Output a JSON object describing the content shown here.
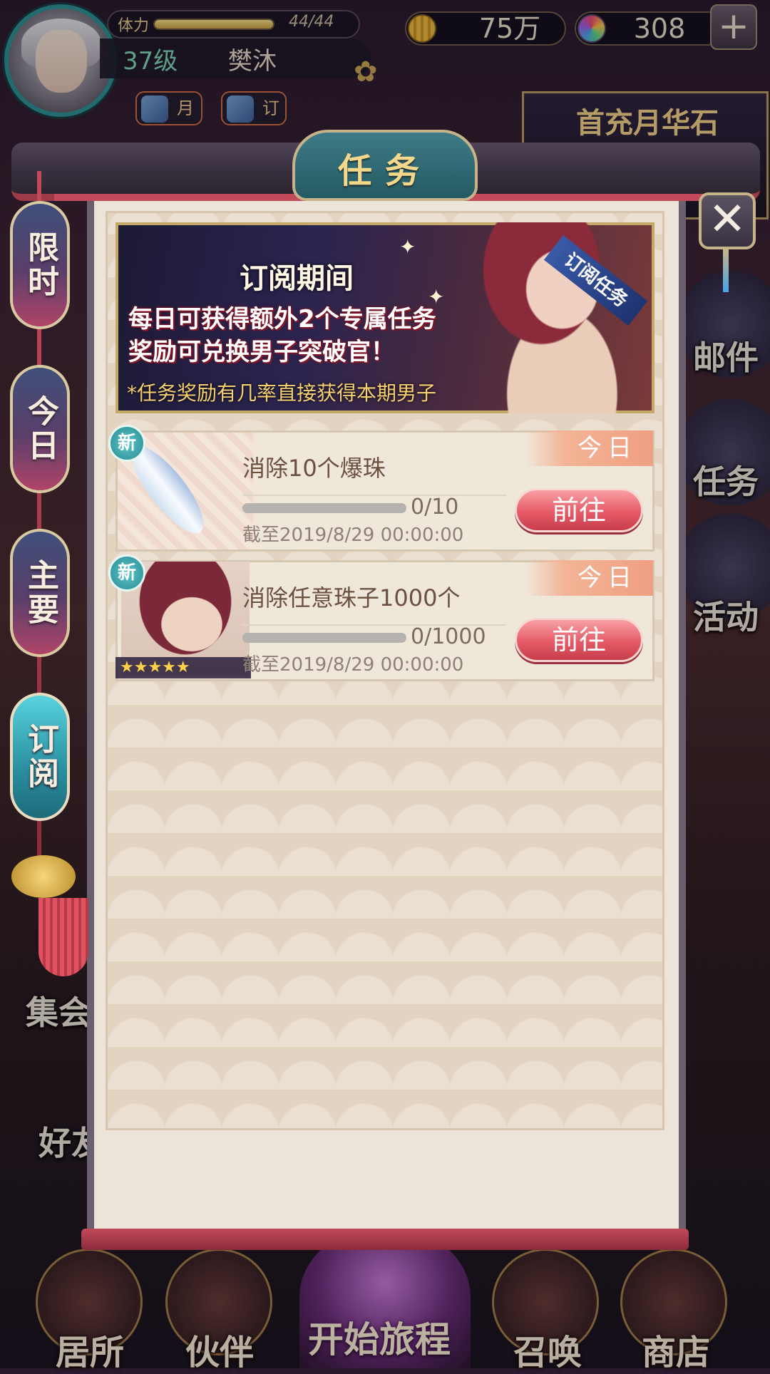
{
  "header": {
    "stamina_label": "体力",
    "stamina_value": "44/44",
    "stamina_fraction": 1.0,
    "level": "37级",
    "player_name": "樊沐",
    "coins": "75万",
    "gems": "308",
    "plus_label": "+",
    "mini_icons": [
      {
        "label": "月"
      },
      {
        "label": "订"
      }
    ],
    "promo_text": "首充月华石"
  },
  "modal": {
    "title": "任务",
    "close_label": "✕"
  },
  "tabs": [
    {
      "label": "限时",
      "active": false
    },
    {
      "label": "今日",
      "active": false
    },
    {
      "label": "主要",
      "active": false
    },
    {
      "label": "订阅",
      "active": true
    }
  ],
  "banner": {
    "title": "订阅期间",
    "line1": "每日可获得额外2个专属任务",
    "line2": "奖励可兑换男子突破官！",
    "note": "*任务奖励有几率直接获得本期男子",
    "ribbon": "订阅任务"
  },
  "tasks": [
    {
      "new_label": "新",
      "name": "消除10个爆珠",
      "progress": "0/10",
      "progress_fraction": 0,
      "deadline": "截至2019/8/29 00:00:00",
      "tag": "今日",
      "button": "前往"
    },
    {
      "new_label": "新",
      "name": "消除任意珠子1000个",
      "progress": "0/1000",
      "progress_fraction": 0,
      "deadline": "截至2019/8/29 00:00:00",
      "tag": "今日",
      "button": "前往",
      "rarity": "★★★★★"
    }
  ],
  "side_menu": [
    {
      "label": "邮件"
    },
    {
      "label": "任务"
    },
    {
      "label": "活动"
    }
  ],
  "left_menu": [
    {
      "label": "集会"
    },
    {
      "label": "好友"
    }
  ],
  "bottom_nav": [
    {
      "label": "居所"
    },
    {
      "label": "伙伴"
    },
    {
      "label": "开始旅程"
    },
    {
      "label": "召唤"
    },
    {
      "label": "商店"
    }
  ]
}
